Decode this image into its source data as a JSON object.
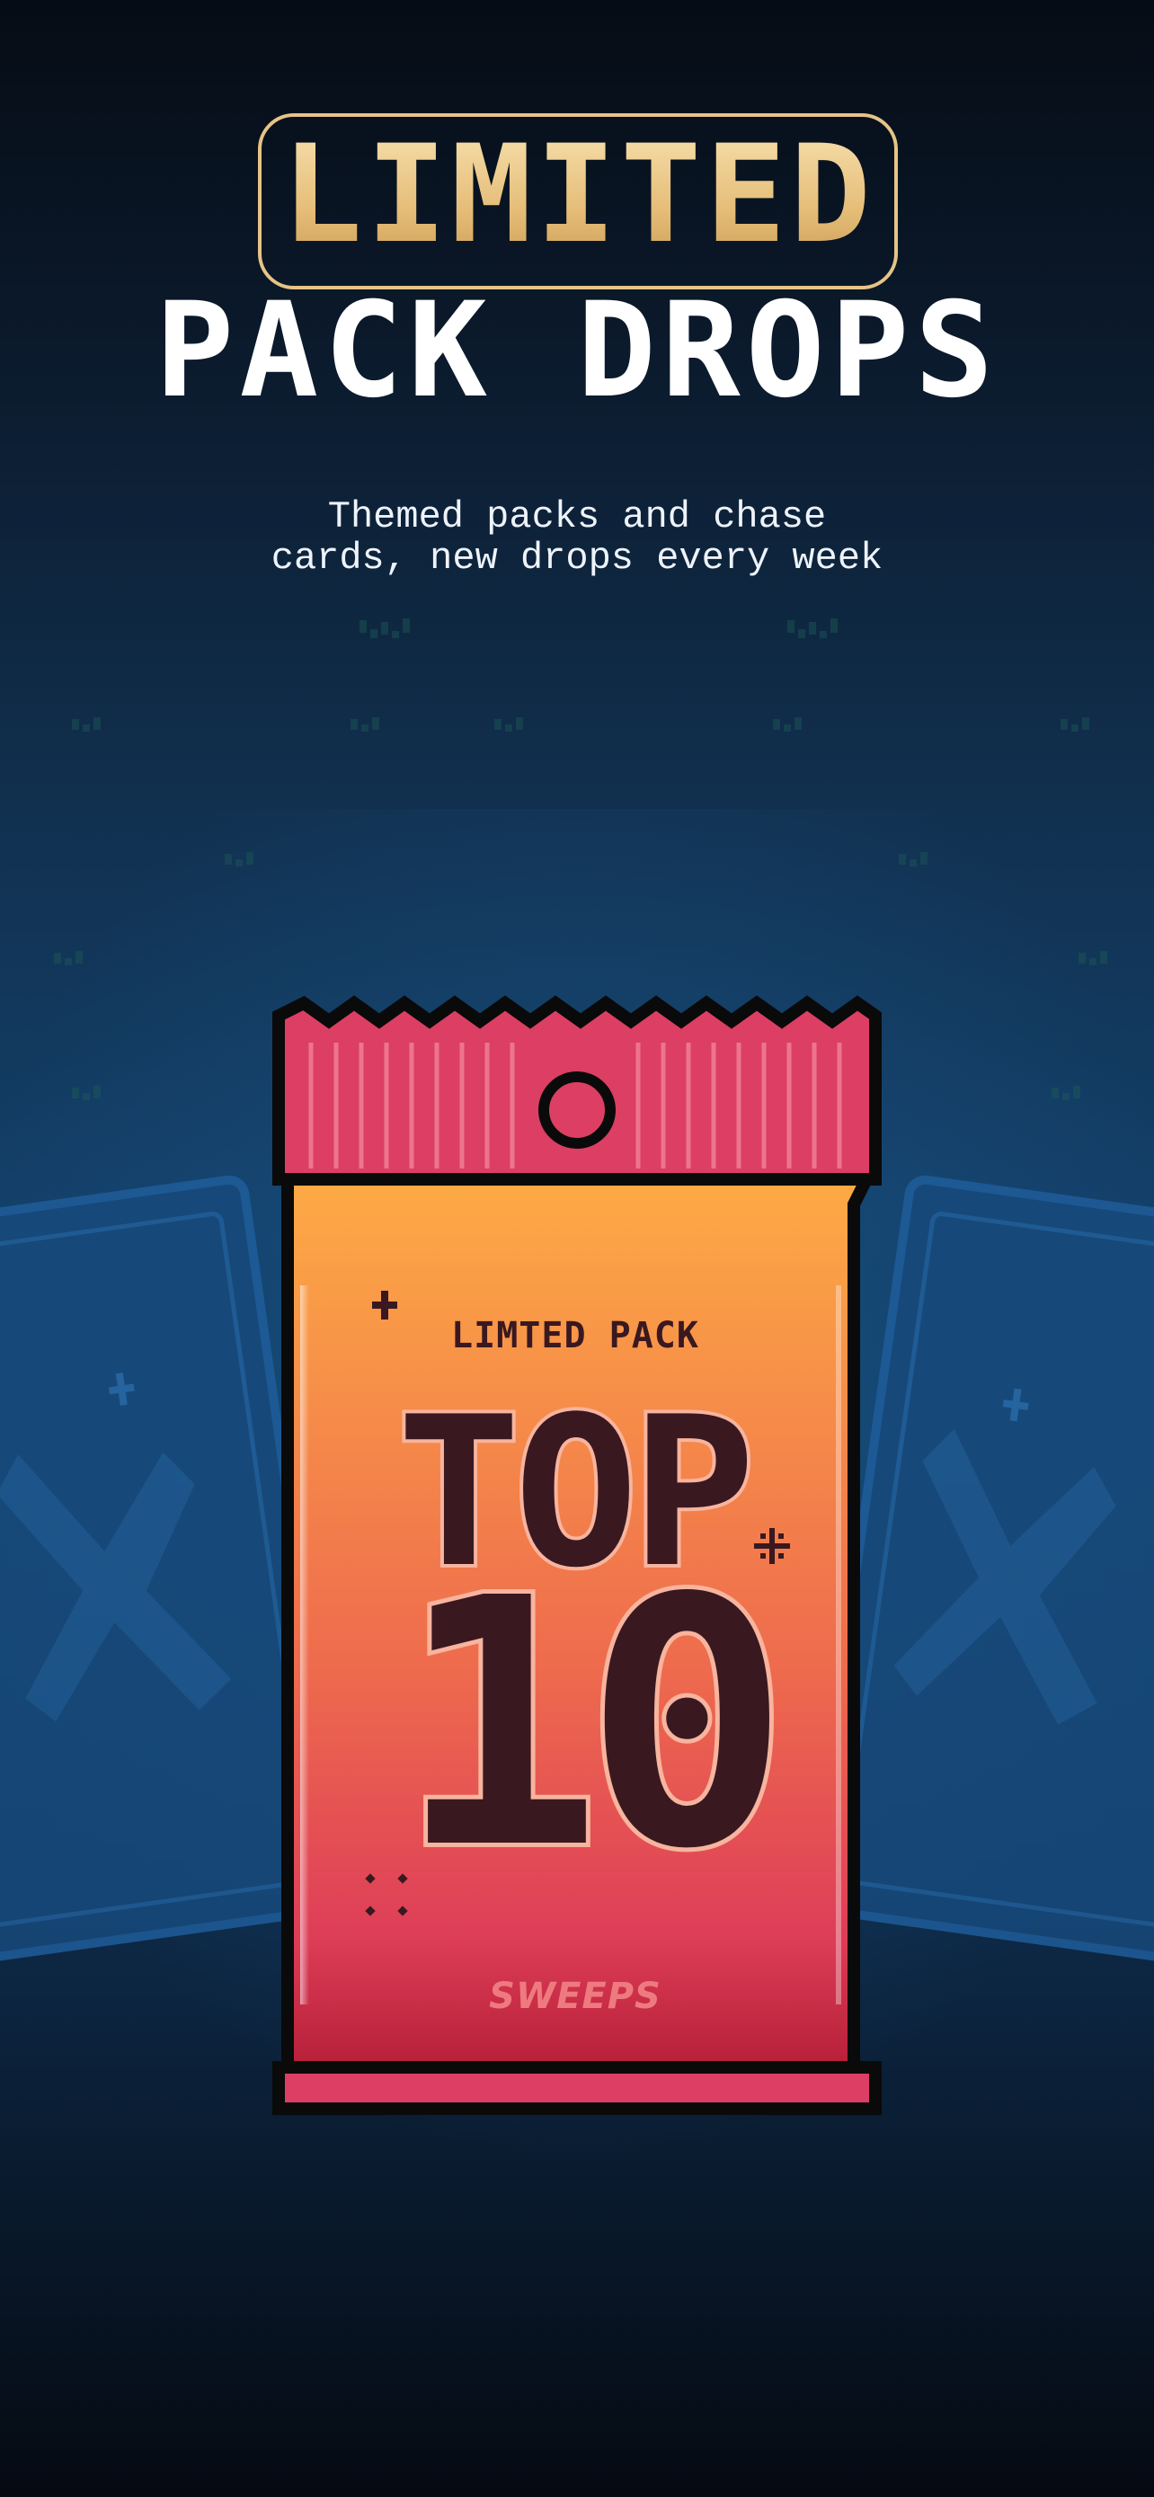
{
  "header": {
    "badge_word": "LIMITED",
    "title": "PACK DROPS",
    "subtitle_lines": [
      "Themed packs and chase",
      "cards, new drops every week"
    ]
  },
  "pack": {
    "label": "LIMTED PACK",
    "top_word": "TOP",
    "number": "10",
    "brand": "SWEEPS"
  },
  "colors": {
    "badge_gold": "#e6c487",
    "pack_crimson": "#dc3f63",
    "pack_orange": "#fda544",
    "pack_ink": "#3a1820",
    "background_blue": "#133f68"
  }
}
